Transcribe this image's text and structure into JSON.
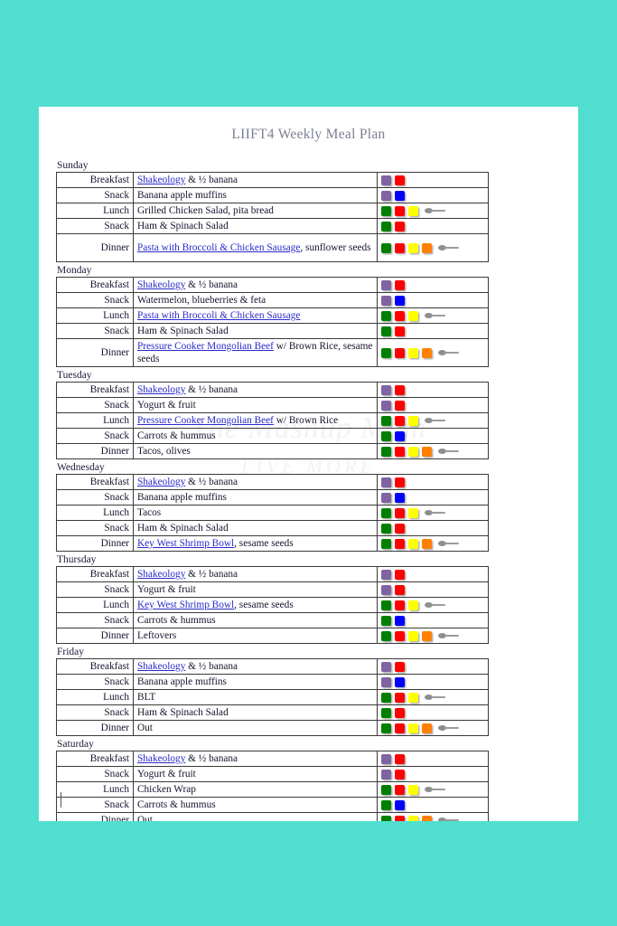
{
  "document": {
    "title": "LIIFT4 Weekly Meal Plan",
    "watermark_line1": "The Mashup Mom",
    "watermark_line2": "LIVE MORE"
  },
  "colors": {
    "background": "#50ded0",
    "page": "#ffffff",
    "title": "#7b7f94",
    "link": "#2a2aca",
    "text": "#14142e",
    "border": "#3a3a3a",
    "container_purple": "#8064a2",
    "container_red": "#ff0000",
    "container_blue": "#0000ff",
    "container_green": "#008000",
    "container_yellow": "#ffff00",
    "container_orange": "#ff8000",
    "spoon_grey": "#8e8e8e"
  },
  "legend": {
    "meal_labels": [
      "Breakfast",
      "Snack",
      "Lunch",
      "Snack",
      "Dinner"
    ],
    "container_names": {
      "purple": "purple-container",
      "red": "red-container",
      "blue": "blue-container",
      "green": "green-container",
      "yellow": "yellow-container",
      "orange": "orange-container",
      "spoon": "teaspoon-icon"
    }
  },
  "days": [
    {
      "name": "Sunday",
      "rows": [
        {
          "meal": "Breakfast",
          "link": "Shakeology",
          "text": " & ½ banana",
          "containers": [
            "purple",
            "red"
          ],
          "spoon": false
        },
        {
          "meal": "Snack",
          "link": "",
          "text": "Banana apple muffins",
          "containers": [
            "purple",
            "blue"
          ],
          "spoon": false
        },
        {
          "meal": "Lunch",
          "link": "",
          "text": "Grilled Chicken Salad, pita bread",
          "containers": [
            "green",
            "red",
            "yellow"
          ],
          "spoon": true
        },
        {
          "meal": "Snack",
          "link": "",
          "text": "Ham & Spinach Salad",
          "containers": [
            "green",
            "red"
          ],
          "spoon": false
        },
        {
          "meal": "Dinner",
          "link": "Pasta with Broccoli & Chicken Sausage",
          "text": ", sunflower seeds",
          "containers": [
            "green",
            "red",
            "yellow",
            "orange"
          ],
          "spoon": true,
          "tall": true
        }
      ]
    },
    {
      "name": "Monday",
      "rows": [
        {
          "meal": "Breakfast",
          "link": "Shakeology",
          "text": " & ½ banana",
          "containers": [
            "purple",
            "red"
          ],
          "spoon": false
        },
        {
          "meal": "Snack",
          "link": "",
          "text": "Watermelon, blueberries & feta",
          "containers": [
            "purple",
            "blue"
          ],
          "spoon": false
        },
        {
          "meal": "Lunch",
          "link": "Pasta with Broccoli & Chicken Sausage",
          "text": "",
          "containers": [
            "green",
            "red",
            "yellow"
          ],
          "spoon": true
        },
        {
          "meal": "Snack",
          "link": "",
          "text": "Ham & Spinach Salad",
          "containers": [
            "green",
            "red"
          ],
          "spoon": false
        },
        {
          "meal": "Dinner",
          "link": "Pressure Cooker Mongolian Beef",
          "text": " w/ Brown Rice, sesame seeds",
          "containers": [
            "green",
            "red",
            "yellow",
            "orange"
          ],
          "spoon": true,
          "tall": true
        }
      ]
    },
    {
      "name": "Tuesday",
      "rows": [
        {
          "meal": "Breakfast",
          "link": "Shakeology",
          "text": " & ½ banana",
          "containers": [
            "purple",
            "red"
          ],
          "spoon": false
        },
        {
          "meal": "Snack",
          "link": "",
          "text": "Yogurt & fruit",
          "containers": [
            "purple",
            "red"
          ],
          "spoon": false
        },
        {
          "meal": "Lunch",
          "link": "Pressure Cooker Mongolian Beef",
          "text": " w/ Brown Rice",
          "containers": [
            "green",
            "red",
            "yellow"
          ],
          "spoon": true
        },
        {
          "meal": "Snack",
          "link": "",
          "text": "Carrots & hummus",
          "containers": [
            "green",
            "blue"
          ],
          "spoon": false
        },
        {
          "meal": "Dinner",
          "link": "",
          "text": "Tacos, olives",
          "containers": [
            "green",
            "red",
            "yellow",
            "orange"
          ],
          "spoon": true
        }
      ]
    },
    {
      "name": "Wednesday",
      "rows": [
        {
          "meal": "Breakfast",
          "link": "Shakeology",
          "text": " & ½ banana",
          "containers": [
            "purple",
            "red"
          ],
          "spoon": false
        },
        {
          "meal": "Snack",
          "link": "",
          "text": "Banana apple muffins",
          "containers": [
            "purple",
            "blue"
          ],
          "spoon": false
        },
        {
          "meal": "Lunch",
          "link": "",
          "text": "Tacos",
          "containers": [
            "green",
            "red",
            "yellow"
          ],
          "spoon": true
        },
        {
          "meal": "Snack",
          "link": "",
          "text": "Ham & Spinach Salad",
          "containers": [
            "green",
            "red"
          ],
          "spoon": false
        },
        {
          "meal": "Dinner",
          "link": "Key West Shrimp Bowl",
          "text": ", sesame seeds",
          "containers": [
            "green",
            "red",
            "yellow",
            "orange"
          ],
          "spoon": true
        }
      ]
    },
    {
      "name": "Thursday",
      "rows": [
        {
          "meal": "Breakfast",
          "link": "Shakeology",
          "text": " & ½ banana",
          "containers": [
            "purple",
            "red"
          ],
          "spoon": false
        },
        {
          "meal": "Snack",
          "link": "",
          "text": "Yogurt & fruit",
          "containers": [
            "purple",
            "red"
          ],
          "spoon": false
        },
        {
          "meal": "Lunch",
          "link": "Key West Shrimp Bowl",
          "text": ", sesame seeds",
          "containers": [
            "green",
            "red",
            "yellow"
          ],
          "spoon": true
        },
        {
          "meal": "Snack",
          "link": "",
          "text": "Carrots & hummus",
          "containers": [
            "green",
            "blue"
          ],
          "spoon": false
        },
        {
          "meal": "Dinner",
          "link": "",
          "text": "Leftovers",
          "containers": [
            "green",
            "red",
            "yellow",
            "orange"
          ],
          "spoon": true
        }
      ]
    },
    {
      "name": "Friday",
      "rows": [
        {
          "meal": "Breakfast",
          "link": "Shakeology",
          "text": " & ½ banana",
          "containers": [
            "purple",
            "red"
          ],
          "spoon": false
        },
        {
          "meal": "Snack",
          "link": "",
          "text": "Banana apple muffins",
          "containers": [
            "purple",
            "blue"
          ],
          "spoon": false
        },
        {
          "meal": "Lunch",
          "link": "",
          "text": "BLT",
          "containers": [
            "green",
            "red",
            "yellow"
          ],
          "spoon": true
        },
        {
          "meal": "Snack",
          "link": "",
          "text": "Ham & Spinach Salad",
          "containers": [
            "green",
            "red"
          ],
          "spoon": false
        },
        {
          "meal": "Dinner",
          "link": "",
          "text": "Out",
          "containers": [
            "green",
            "red",
            "yellow",
            "orange"
          ],
          "spoon": true
        }
      ]
    },
    {
      "name": "Saturday",
      "rows": [
        {
          "meal": "Breakfast",
          "link": "Shakeology",
          "text": " & ½ banana",
          "containers": [
            "purple",
            "red"
          ],
          "spoon": false
        },
        {
          "meal": "Snack",
          "link": "",
          "text": "Yogurt & fruit",
          "containers": [
            "purple",
            "red"
          ],
          "spoon": false
        },
        {
          "meal": "Lunch",
          "link": "",
          "text": "Chicken Wrap",
          "containers": [
            "green",
            "red",
            "yellow"
          ],
          "spoon": true
        },
        {
          "meal": "Snack",
          "link": "",
          "text": "Carrots & hummus",
          "containers": [
            "green",
            "blue"
          ],
          "spoon": false
        },
        {
          "meal": "Dinner",
          "link": "",
          "text": "Out",
          "containers": [
            "green",
            "red",
            "yellow",
            "orange"
          ],
          "spoon": true
        }
      ]
    }
  ]
}
